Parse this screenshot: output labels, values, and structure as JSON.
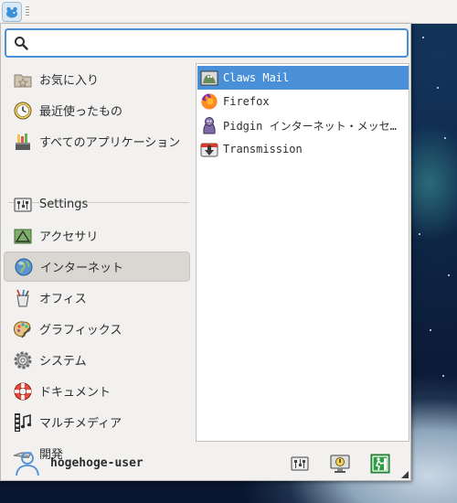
{
  "search": {
    "value": "",
    "placeholder": ""
  },
  "categories": [
    {
      "label": "お気に入り",
      "icon": "favorites-icon"
    },
    {
      "label": "最近使ったもの",
      "icon": "recent-clock-icon"
    },
    {
      "label": "すべてのアプリケーション",
      "icon": "all-applications-icon"
    },
    {
      "label": "Settings",
      "icon": "settings-icon"
    },
    {
      "label": "アクセサリ",
      "icon": "accessories-icon"
    },
    {
      "label": "インターネット",
      "icon": "internet-globe-icon",
      "active": true
    },
    {
      "label": "オフィス",
      "icon": "office-icon"
    },
    {
      "label": "グラフィックス",
      "icon": "graphics-palette-icon"
    },
    {
      "label": "システム",
      "icon": "system-gear-icon"
    },
    {
      "label": "ドキュメント",
      "icon": "help-lifebuoy-icon"
    },
    {
      "label": "マルチメディア",
      "icon": "multimedia-film-icon"
    },
    {
      "label": "開発",
      "icon": "development-icon"
    }
  ],
  "apps": [
    {
      "label": "Claws Mail",
      "icon": "claws-mail-icon",
      "selected": true
    },
    {
      "label": "Firefox",
      "icon": "firefox-icon"
    },
    {
      "label": "Pidgin インターネット・メッセンジャー",
      "icon": "pidgin-icon"
    },
    {
      "label": "Transmission",
      "icon": "transmission-icon"
    }
  ],
  "footer": {
    "username": "hogehoge-user",
    "buttons": [
      "settings-manager-icon",
      "lock-screen-icon",
      "log-out-icon"
    ]
  },
  "colors": {
    "selection": "#4a90d9",
    "active_category": "#dad7d3",
    "menu_bg": "#f2f1f0"
  }
}
